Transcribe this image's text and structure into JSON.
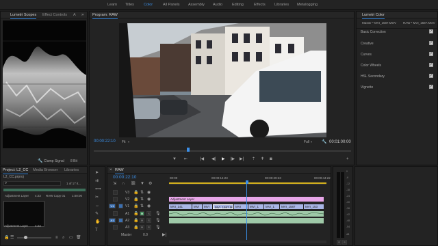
{
  "workspaces": [
    "Learn",
    "Titles",
    "Color",
    "All Panels",
    "Assembly",
    "Audio",
    "Editing",
    "Effects",
    "Libraries",
    "Metalogging"
  ],
  "active_workspace": "Color",
  "scopes": {
    "tab_active": "Lumetri Scopes",
    "tab_other": "Effect Controls",
    "tab_overflow": "A",
    "clamp_label": "Clamp Signal",
    "bit_depth": "8 Bit"
  },
  "program": {
    "title": "Program: RAW",
    "timecode": "00:00:22:10",
    "fit": "Fit",
    "quality": "Full",
    "duration": "00:01:00:00"
  },
  "lumetri": {
    "title": "Lumetri Color",
    "master": "Master * MVI_1587.MOV",
    "clip": "RAW * MVI_1587.MOV",
    "sections": [
      "Basic Correction",
      "Creative",
      "Curves",
      "Color Wheels",
      "HSL Secondary",
      "Vignette"
    ]
  },
  "project": {
    "tabs": [
      "Project: L2_CC",
      "Media Browser",
      "Libraries"
    ],
    "file": "L2_CC.prproj",
    "count": "1 of 17 it...",
    "items": [
      {
        "name": "Adjustment Layer",
        "duration": "4:23"
      },
      {
        "name": "RAW Copy 01",
        "duration": "1:00:00"
      }
    ],
    "thumb_label": "Adjustment Layer",
    "thumb_duration": "4:23"
  },
  "timeline": {
    "tab": "RAW",
    "timecode": "00:00:22:10",
    "ruler": [
      "00:00",
      "00:00:14:23",
      "00:00:29:23",
      "00:00:44:22"
    ],
    "video_tracks": [
      "V3",
      "V2",
      "V1"
    ],
    "audio_tracks": [
      "A1",
      "A2",
      "A3"
    ],
    "master": "Master",
    "master_val": "0.0",
    "adj_clip": "Adjustment Layer",
    "v1_clips": [
      "MVI_141",
      "MVI",
      "MVI",
      "MVI_1587.M",
      "MVI",
      "MVI_1",
      "MVI_1",
      "MVI_1587",
      "MVI_153"
    ],
    "v1_marker": "fx",
    "src_track": "V1",
    "src_audio": "A1"
  },
  "meter_ticks": [
    "0",
    "-6",
    "-12",
    "-18",
    "-24",
    "-30",
    "-36",
    "-42",
    "-48",
    "-54",
    "dB"
  ],
  "colors": {
    "accent": "#3b8fe8",
    "adj_clip": "#e7a6e8",
    "video_clip": "#a9b6e6",
    "audio_clip": "#9fc9a8",
    "playhead": "#3b8fe8"
  }
}
